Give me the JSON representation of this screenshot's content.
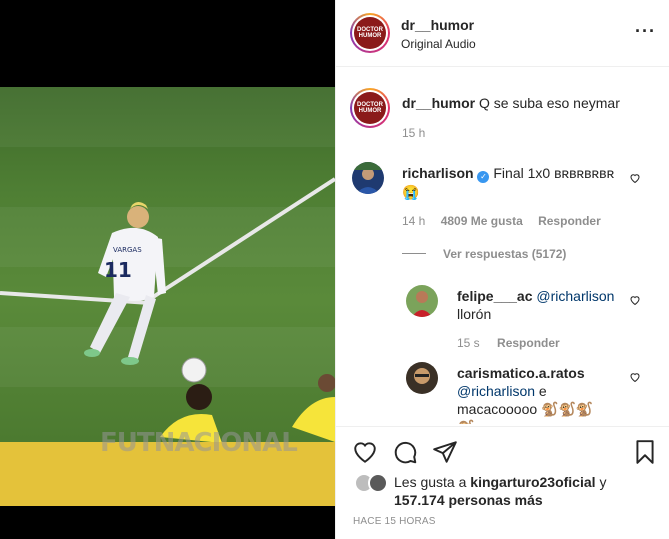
{
  "post": {
    "author": "dr__humor",
    "audio": "Original Audio",
    "avatar_text": "DOCTOR HUMOR",
    "watermark": "FUTNACIONAL",
    "jersey_name": "VARGAS",
    "jersey_number": "11"
  },
  "caption": {
    "author": "dr__humor",
    "text": "Q se suba eso neymar",
    "time": "15 h"
  },
  "comments": [
    {
      "author": "richarlison",
      "verified": true,
      "text": "Final 1x0 ʙʀʙʀʙʀʙʀ",
      "emoji": "😭",
      "time": "14 h",
      "likes": "4809 Me gusta",
      "reply": "Responder",
      "view_replies": "Ver respuestas (5172)"
    }
  ],
  "replies": [
    {
      "author": "felipe___ac",
      "mention": "@richarlison",
      "text": "llorón",
      "time": "15 s",
      "reply": "Responder"
    },
    {
      "author": "carismatico.a.ratos",
      "mention": "@richarlison",
      "text_after": "e",
      "text_line2": "macacooooo 🐒🐒🐒",
      "text_line3": "🐒"
    }
  ],
  "likes": {
    "prefix": "Les gusta a",
    "user": "kingarturo23oficial",
    "connector": "y",
    "count": "157.174 personas más"
  },
  "timestamp": "HACE 15 HORAS",
  "icons": {
    "like": "heart-icon",
    "comment": "comment-icon",
    "share": "share-icon",
    "save": "bookmark-icon",
    "more": "more-options-icon"
  }
}
